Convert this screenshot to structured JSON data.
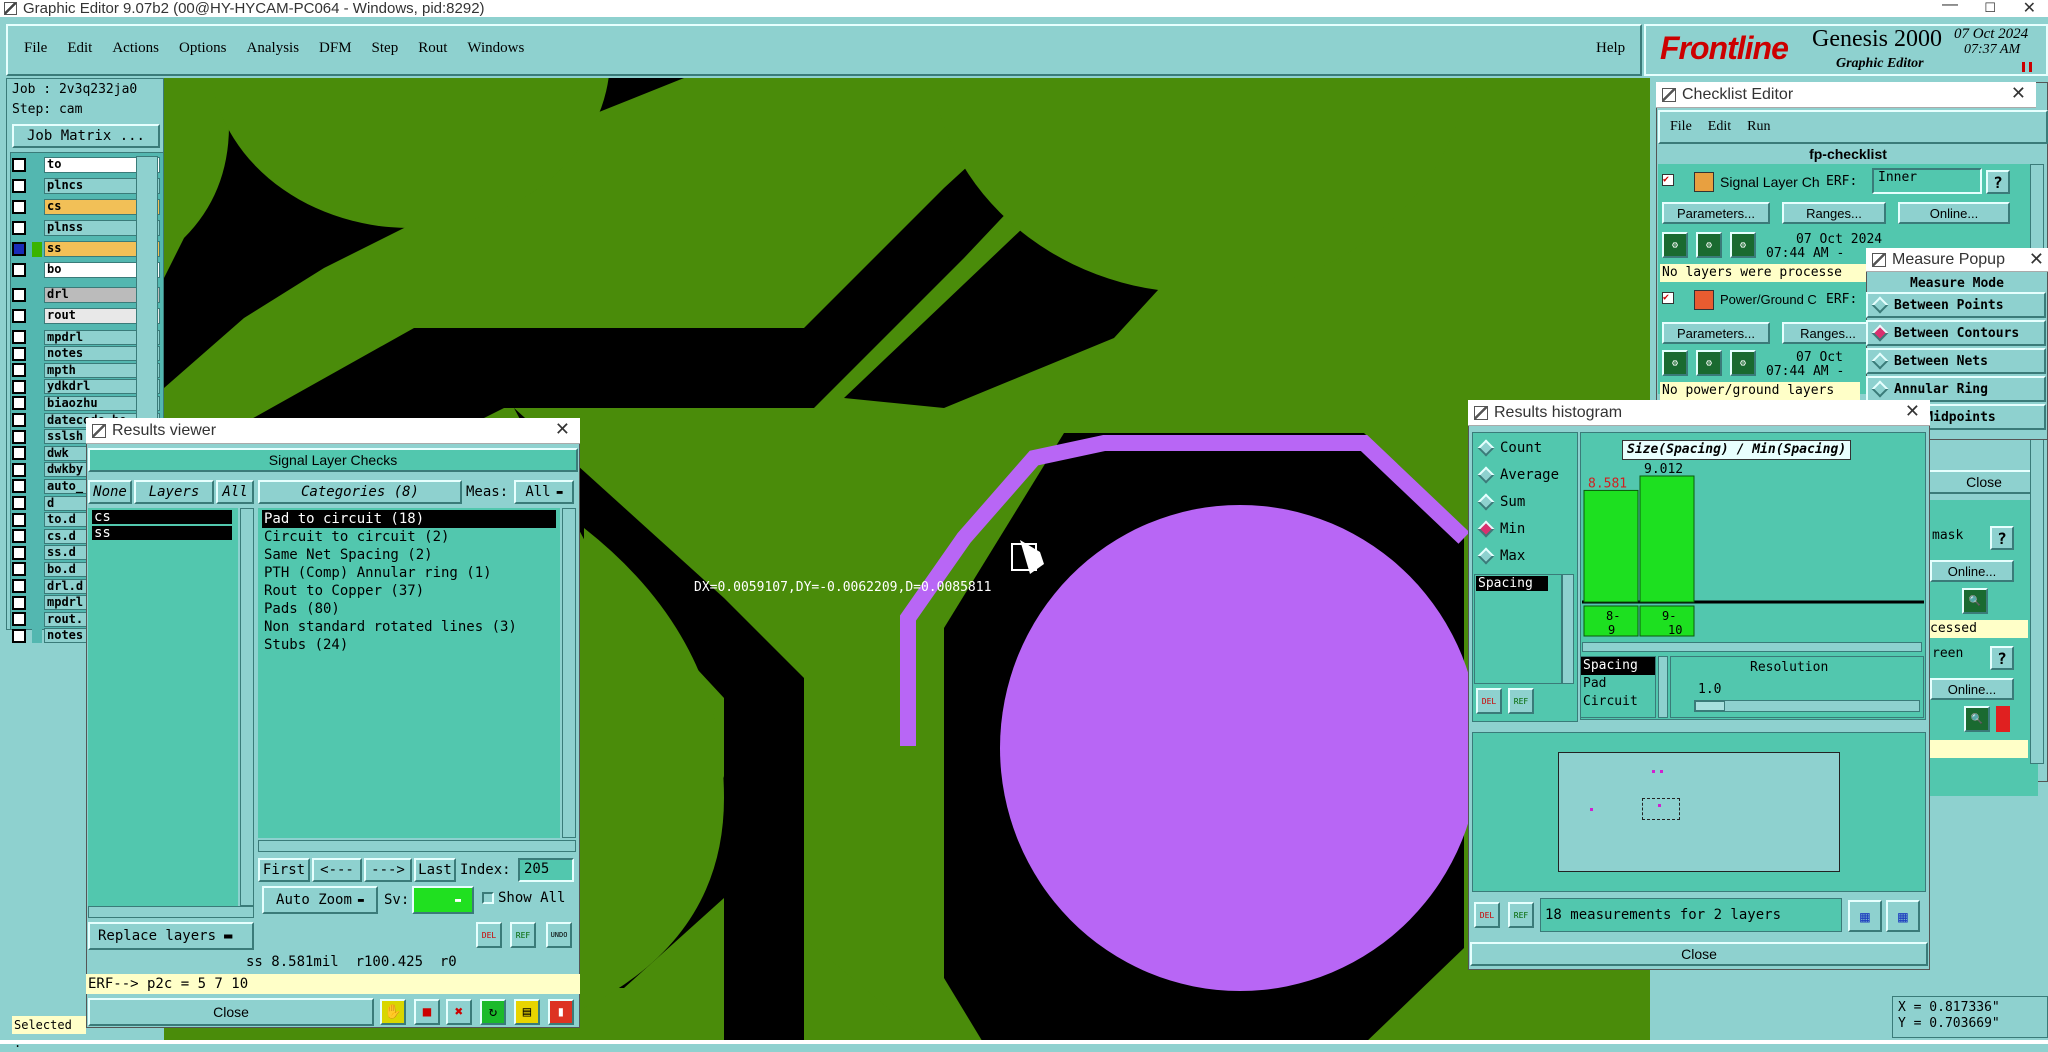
{
  "window": {
    "title": "Graphic Editor 9.07b2 (00@HY-HYCAM-PC064 - Windows, pid:8292)"
  },
  "menu": {
    "items": [
      "File",
      "Edit",
      "Actions",
      "Options",
      "Analysis",
      "DFM",
      "Step",
      "Rout",
      "Windows"
    ],
    "help": "Help"
  },
  "brand": {
    "logo": "Frontline",
    "product": "Genesis 2000",
    "subtitle": "Graphic Editor",
    "date": "07 Oct 2024",
    "time": "07:37 AM"
  },
  "job": {
    "job": "Job : 2v3q232ja0",
    "step": "Step: cam",
    "matrix_button": "Job Matrix ..."
  },
  "layers": [
    "to",
    "plncs",
    "cs",
    "plnss",
    "ss",
    "bo",
    "drl",
    "rout",
    "mpdrl",
    "notes",
    "mpth",
    "ydkdrl",
    "biaozhu",
    "datecode-bo",
    "sslsh",
    "dwk",
    "dwkby",
    "auto_",
    "d",
    "to.d",
    "cs.d",
    "ss.d",
    "bo.d",
    "drl.d",
    "mpdrl",
    "rout.",
    "notes"
  ],
  "status_left": "Selected :",
  "canvas": {
    "measure_text": "DX=0.0059107,DY=-0.0062209,D=0.0085811",
    "colors": {
      "copper": "#4a8c0a",
      "pad": "#b866f5",
      "board": "#000000"
    }
  },
  "results_viewer": {
    "title": "Results viewer",
    "header": "Signal Layer Checks",
    "none_btn": "None",
    "layers_btn": "Layers",
    "all_btn": "All",
    "layers": [
      "cs",
      "ss"
    ],
    "categories_btn": "Categories (8)",
    "meas_label": "Meas:",
    "meas_value": "All",
    "categories": [
      "Pad to circuit (18)",
      "Circuit to circuit (2)",
      "Same Net Spacing (2)",
      "PTH (Comp) Annular ring (1)",
      "Rout to Copper (37)",
      "Pads (80)",
      "Non standard rotated lines (3)",
      "Stubs (24)"
    ],
    "nav": {
      "first": "First",
      "prev": "<---",
      "next": "--->",
      "last": "Last",
      "index_label": "Index:",
      "index_value": "205"
    },
    "auto_zoom": "Auto Zoom",
    "sv_label": "Sv:",
    "show_all": "Show All",
    "replace_layers": "Replace layers",
    "status": "ss 8.581mil  r100.425  r0",
    "erf": "ERF--> p2c = 5 7 10",
    "close": "Close",
    "small_btns": [
      "DEL",
      "REF",
      "UNDO"
    ]
  },
  "checklist": {
    "title": "Checklist Editor",
    "menu": [
      "File",
      "Edit",
      "Run"
    ],
    "name": "fp-checklist",
    "items": [
      {
        "name": "Signal Layer Ch",
        "erf_label": "ERF:",
        "erf_value": "Inner",
        "params": "Parameters...",
        "ranges": "Ranges...",
        "online": "Online...",
        "date": "07 Oct 2024",
        "time": "07:44 AM -",
        "msg": "No layers were processe"
      },
      {
        "name": "Power/Ground C",
        "erf_label": "ERF:",
        "params": "Parameters...",
        "ranges": "Ranges...",
        "date": "07 Oct",
        "time": "07:44 AM -",
        "msg": "No power/ground layers"
      }
    ],
    "side": {
      "close": "Close",
      "mask": "mask",
      "online1": "Online...",
      "cessed": "cessed",
      "green": "reen",
      "online2": "Online...",
      "help": "?"
    }
  },
  "measure_popup": {
    "title": "Measure Popup",
    "header": "Measure Mode",
    "options": [
      "Between Points",
      "Between Contours",
      "Between Nets",
      "Annular Ring",
      "een Midpoints"
    ],
    "selected": 1
  },
  "histogram": {
    "title": "Results histogram",
    "stats": [
      "Count",
      "Average",
      "Sum",
      "Min",
      "Max"
    ],
    "selected_stat": 3,
    "list": [
      "Spacing"
    ],
    "chart_title": "Size(Spacing) / Min(Spacing)",
    "bars": [
      {
        "label": "8.581",
        "bin": "8-9"
      },
      {
        "label": "9.012",
        "bin": "9-10"
      }
    ],
    "measure_list": [
      "Spacing",
      "Pad",
      "Circuit"
    ],
    "resolution_label": "Resolution",
    "resolution_value": "1.0",
    "summary": "18 measurements for 2 layers",
    "close": "Close",
    "small_btns": [
      "DEL",
      "REF"
    ]
  },
  "coords": {
    "x": "X = 0.817336\"",
    "y": "Y = 0.703669\""
  }
}
